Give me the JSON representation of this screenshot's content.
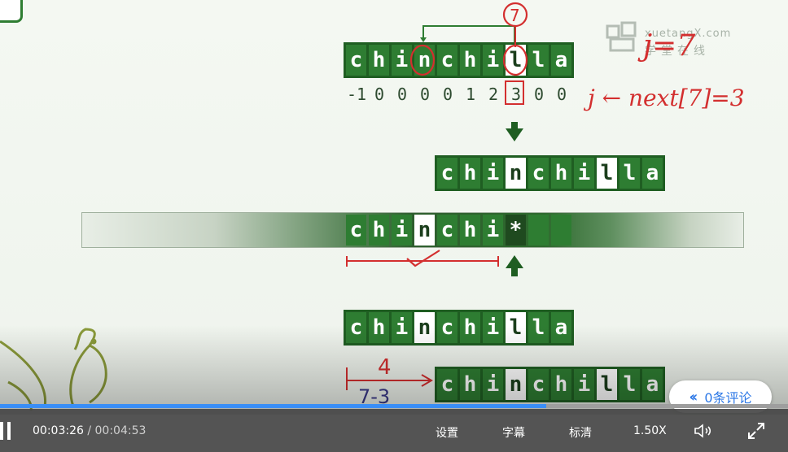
{
  "slide": {
    "top_row": [
      "c",
      "h",
      "i",
      "n",
      "c",
      "h",
      "i",
      "l",
      "l",
      "a"
    ],
    "next_values": [
      "-1",
      "0",
      "0",
      "0",
      "0",
      "1",
      "2",
      "3",
      "0",
      "0"
    ],
    "pattern_shifted": [
      "c",
      "h",
      "i",
      "n",
      "c",
      "h",
      "i",
      "l",
      "l",
      "a"
    ],
    "text_row": [
      "c",
      "h",
      "i",
      "n",
      "c",
      "h",
      "i",
      "*",
      "",
      ""
    ],
    "bottom_row": [
      "c",
      "h",
      "i",
      "n",
      "c",
      "h",
      "i",
      "l",
      "l",
      "a"
    ],
    "shifted_row": [
      "c",
      "h",
      "i",
      "n",
      "c",
      "h",
      "i",
      "l",
      "l",
      "a"
    ],
    "annotations": {
      "circled_seven": "7",
      "j_eq": "j=7",
      "j_next": "j ← next[7]=3",
      "four": "4",
      "seven_minus_three": "7-3"
    }
  },
  "watermark": {
    "en": "xuetangX.com",
    "cn": "学堂在线"
  },
  "player": {
    "progress_fraction": 0.693,
    "current_time": "00:03:26",
    "separator": "/",
    "total_time": "00:04:53",
    "settings_label": "设置",
    "subtitle_label": "字幕",
    "quality_label": "标清",
    "speed_label": "1.50X",
    "comment_label": "0条评论",
    "colors": {
      "accent": "#3a8ef6",
      "comment_text": "#2b77e6"
    }
  },
  "icons": [
    "pause-icon",
    "volume-icon",
    "fullscreen-icon",
    "chevron-left-icon"
  ]
}
